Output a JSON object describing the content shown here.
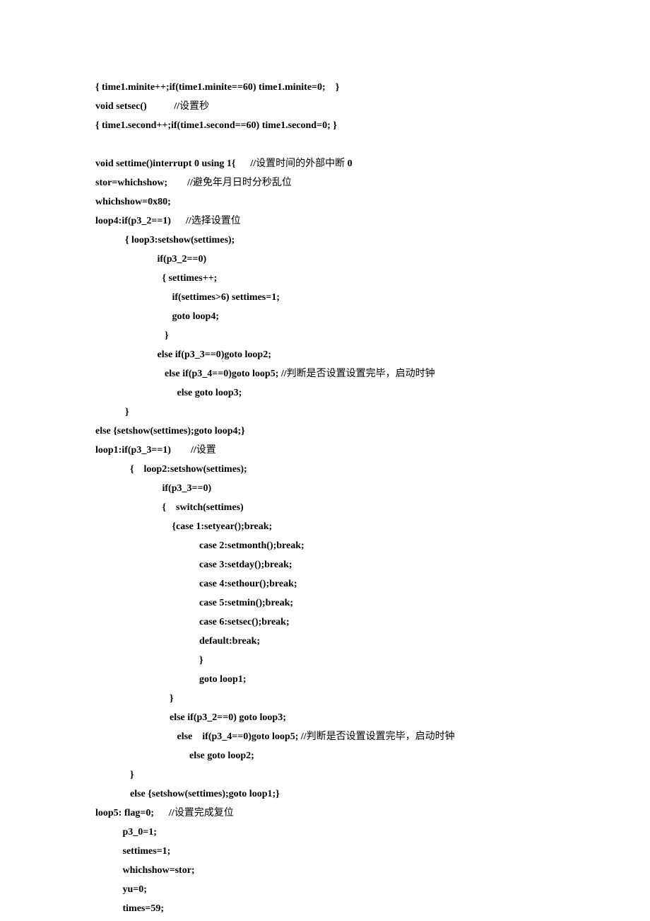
{
  "lines": [
    {
      "text": "{ time1.minite++;if(time1.minite==60) time1.minite=0;    }"
    },
    {
      "seg": [
        {
          "t": "void setsec()           //"
        },
        {
          "t": "设置秒",
          "cjk": true
        }
      ]
    },
    {
      "text": "{ time1.second++;if(time1.second==60) time1.second=0; }"
    },
    {
      "text": ""
    },
    {
      "seg": [
        {
          "t": "void settime()interrupt 0 using 1{      //"
        },
        {
          "t": "设置时间的外部中断",
          "cjk": true
        },
        {
          "t": " 0"
        }
      ]
    },
    {
      "seg": [
        {
          "t": "stor=whichshow;        //"
        },
        {
          "t": "避免年月日时分秒乱位",
          "cjk": true
        }
      ]
    },
    {
      "text": "whichshow=0x80;"
    },
    {
      "seg": [
        {
          "t": "loop4:if(p3_2==1)      //"
        },
        {
          "t": "选择设置位",
          "cjk": true
        }
      ]
    },
    {
      "text": "            { loop3:setshow(settimes);"
    },
    {
      "text": "                         if(p3_2==0)"
    },
    {
      "text": "                           { settimes++;"
    },
    {
      "text": "                               if(settimes>6) settimes=1;"
    },
    {
      "text": "                               goto loop4;"
    },
    {
      "text": "                            }"
    },
    {
      "text": "                         else if(p3_3==0)goto loop2;"
    },
    {
      "seg": [
        {
          "t": "                            else if(p3_4==0)goto loop5; //"
        },
        {
          "t": "判断是否设置设置完毕，启动时钟",
          "cjk": true
        }
      ]
    },
    {
      "text": "                                 else goto loop3;"
    },
    {
      "text": "            }"
    },
    {
      "text": "else {setshow(settimes);goto loop4;}"
    },
    {
      "seg": [
        {
          "t": "loop1:if(p3_3==1)        //"
        },
        {
          "t": "设置",
          "cjk": true
        }
      ]
    },
    {
      "text": "              {    loop2:setshow(settimes);"
    },
    {
      "text": "                           if(p3_3==0)"
    },
    {
      "text": "                           {    switch(settimes)"
    },
    {
      "text": "                               {case 1:setyear();break;"
    },
    {
      "text": "                                          case 2:setmonth();break;"
    },
    {
      "text": "                                          case 3:setday();break;"
    },
    {
      "text": "                                          case 4:sethour();break;"
    },
    {
      "text": "                                          case 5:setmin();break;"
    },
    {
      "text": "                                          case 6:setsec();break;"
    },
    {
      "text": "                                          default:break;"
    },
    {
      "text": "                                          }"
    },
    {
      "text": "                                          goto loop1;"
    },
    {
      "text": "                              }"
    },
    {
      "text": "                              else if(p3_2==0) goto loop3;"
    },
    {
      "seg": [
        {
          "t": "                                 else    if(p3_4==0)goto loop5; //"
        },
        {
          "t": "判断是否设置设置完毕，启动时钟",
          "cjk": true
        }
      ]
    },
    {
      "text": "                                      else goto loop2;"
    },
    {
      "text": "              }"
    },
    {
      "text": "              else {setshow(settimes);goto loop1;}"
    },
    {
      "seg": [
        {
          "t": "loop5: flag=0;      //"
        },
        {
          "t": "设置完成复位",
          "cjk": true
        }
      ]
    },
    {
      "text": "           p3_0=1;"
    },
    {
      "text": "           settimes=1;"
    },
    {
      "text": "           whichshow=stor;"
    },
    {
      "text": "           yu=0;"
    },
    {
      "text": "           times=59;"
    }
  ]
}
